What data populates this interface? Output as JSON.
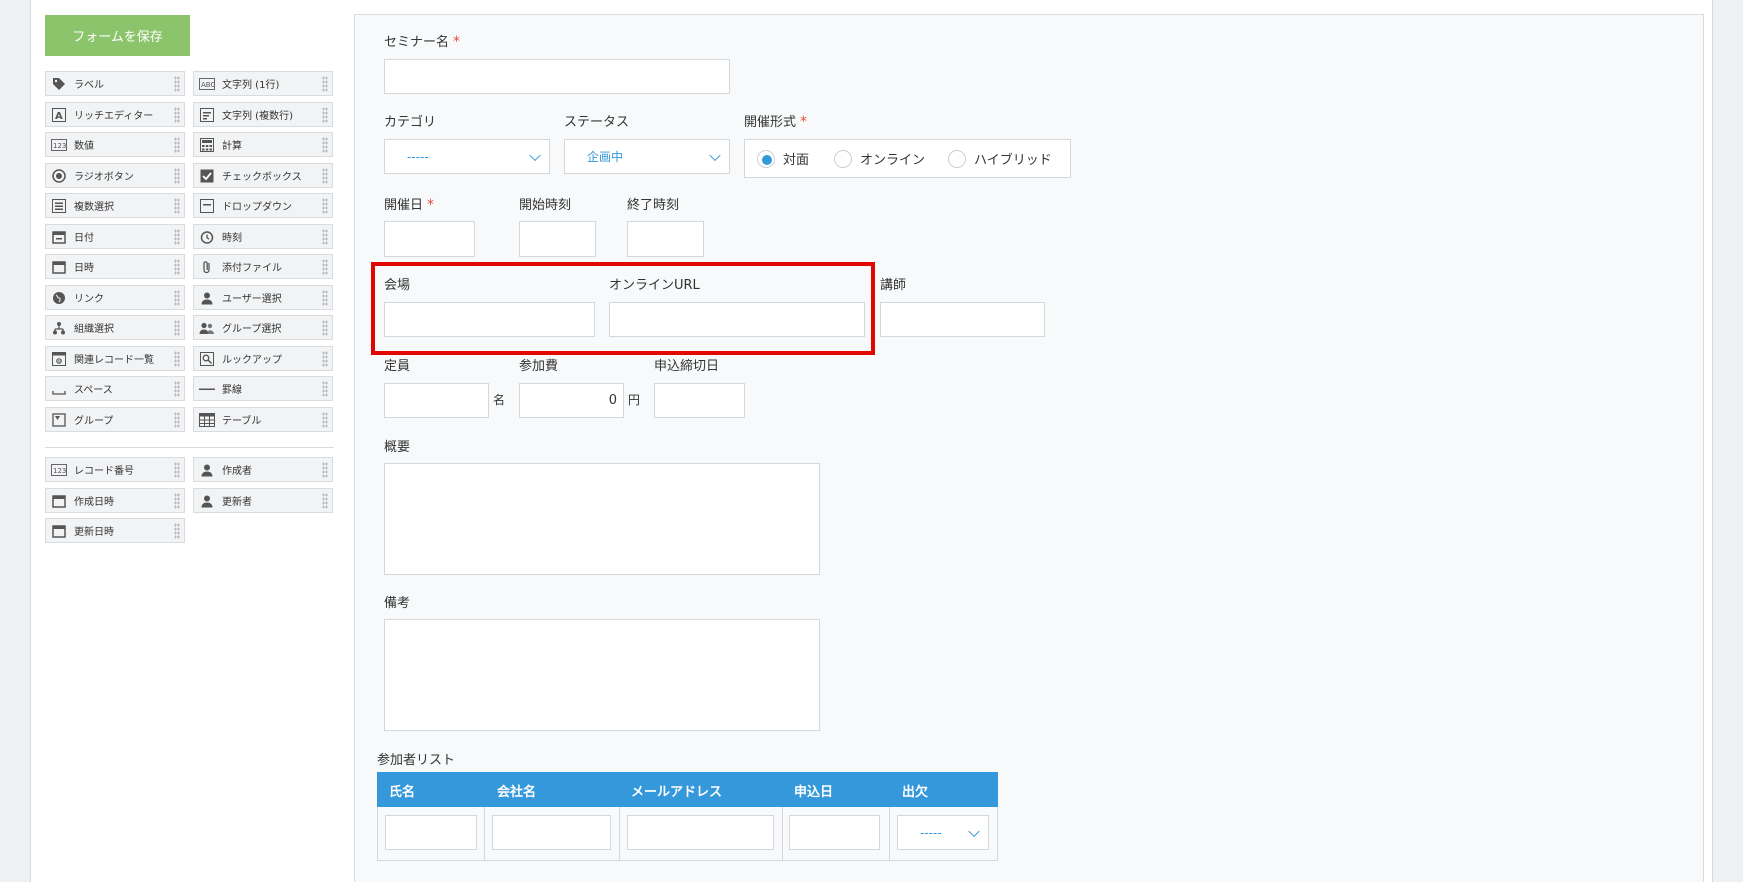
{
  "toolbar": {
    "save_label": "フォームを保存"
  },
  "palette": {
    "fields": [
      "ラベル",
      "文字列 (1行)",
      "リッチエディター",
      "文字列 (複数行)",
      "数値",
      "計算",
      "ラジオボタン",
      "チェックボックス",
      "複数選択",
      "ドロップダウン",
      "日付",
      "時刻",
      "日時",
      "添付ファイル",
      "リンク",
      "ユーザー選択",
      "組織選択",
      "グループ選択",
      "関連レコード一覧",
      "ルックアップ",
      "スペース",
      "罫線",
      "グループ",
      "テーブル"
    ],
    "system_fields": [
      "レコード番号",
      "作成者",
      "作成日時",
      "更新者",
      "更新日時"
    ]
  },
  "form": {
    "seminar_name": {
      "label": "セミナー名",
      "required_mark": "*"
    },
    "category": {
      "label": "カテゴリ",
      "value": "-----"
    },
    "status": {
      "label": "ステータス",
      "value": "企画中"
    },
    "format": {
      "label": "開催形式",
      "required_mark": "*",
      "options": [
        "対面",
        "オンライン",
        "ハイブリッド"
      ],
      "selected": "対面"
    },
    "date": {
      "label": "開催日",
      "required_mark": "*"
    },
    "start_time": {
      "label": "開始時刻"
    },
    "end_time": {
      "label": "終了時刻"
    },
    "venue": {
      "label": "会場"
    },
    "online_url": {
      "label": "オンラインURL"
    },
    "instructor": {
      "label": "講師"
    },
    "capacity": {
      "label": "定員",
      "unit": "名"
    },
    "fee": {
      "label": "参加費",
      "value": "0",
      "unit": "円"
    },
    "deadline": {
      "label": "申込締切日"
    },
    "summary": {
      "label": "概要"
    },
    "notes": {
      "label": "備考"
    },
    "participants": {
      "label": "参加者リスト",
      "columns": [
        "氏名",
        "会社名",
        "メールアドレス",
        "申込日",
        "出欠"
      ],
      "attendance_value": "-----"
    }
  },
  "colors": {
    "accent": "#3498db",
    "save_button": "#8bc46b",
    "required": "#e74c3c",
    "highlight": "#e10600"
  }
}
